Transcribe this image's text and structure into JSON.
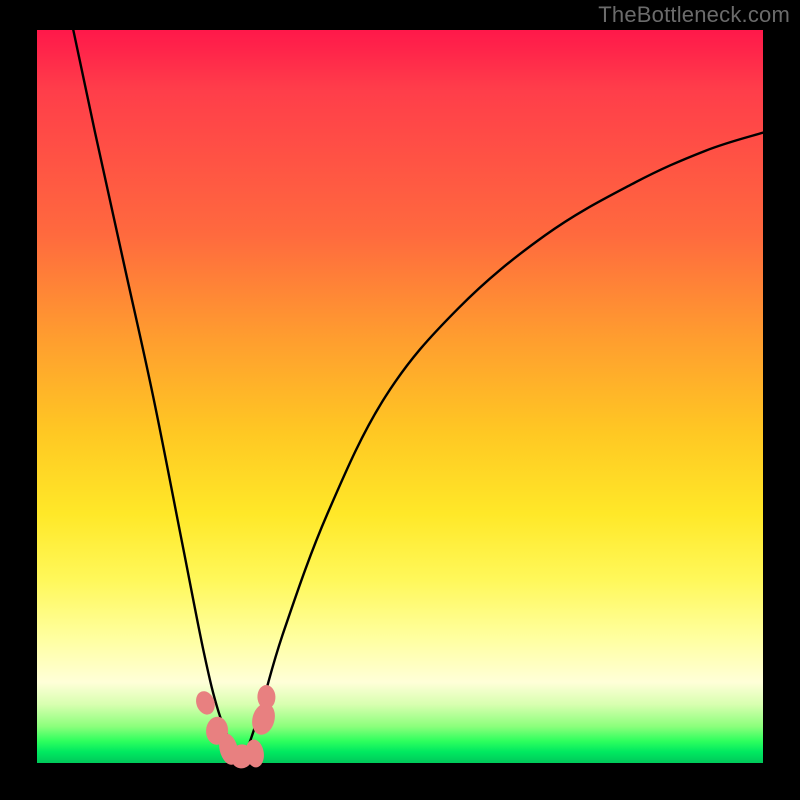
{
  "watermark": "TheBottleneck.com",
  "chart_data": {
    "type": "line",
    "title": "",
    "xlabel": "",
    "ylabel": "",
    "x_range": [
      0,
      100
    ],
    "y_range": [
      0,
      100
    ],
    "note": "Black V-shaped curve over a vertical red→green gradient. Left branch falls steeply from top-left to a minimum near x≈28, right branch rises with decreasing slope toward upper-right. A handful of salmon-colored blob markers sit in the trough near the minimum.",
    "series": [
      {
        "name": "curve",
        "x": [
          5,
          8,
          12,
          16,
          20,
          23,
          25,
          27,
          28,
          29,
          31,
          34,
          40,
          48,
          58,
          70,
          82,
          92,
          100
        ],
        "y": [
          100,
          86,
          68,
          50,
          30,
          15,
          7,
          2,
          0,
          2,
          8,
          18,
          34,
          50,
          62,
          72,
          79,
          83.5,
          86
        ]
      }
    ],
    "markers": {
      "name": "trough-markers",
      "points": [
        {
          "x": 23.2,
          "y": 8.2
        },
        {
          "x": 24.8,
          "y": 4.4
        },
        {
          "x": 26.4,
          "y": 1.9
        },
        {
          "x": 28.2,
          "y": 0.9
        },
        {
          "x": 30.0,
          "y": 1.3
        },
        {
          "x": 31.2,
          "y": 6.0
        },
        {
          "x": 31.6,
          "y": 9.0
        }
      ]
    },
    "gradient_stops": [
      {
        "pos": 0,
        "color": "#ff184a"
      },
      {
        "pos": 50,
        "color": "#ffb028"
      },
      {
        "pos": 80,
        "color": "#ffff80"
      },
      {
        "pos": 100,
        "color": "#00d85e"
      }
    ]
  }
}
